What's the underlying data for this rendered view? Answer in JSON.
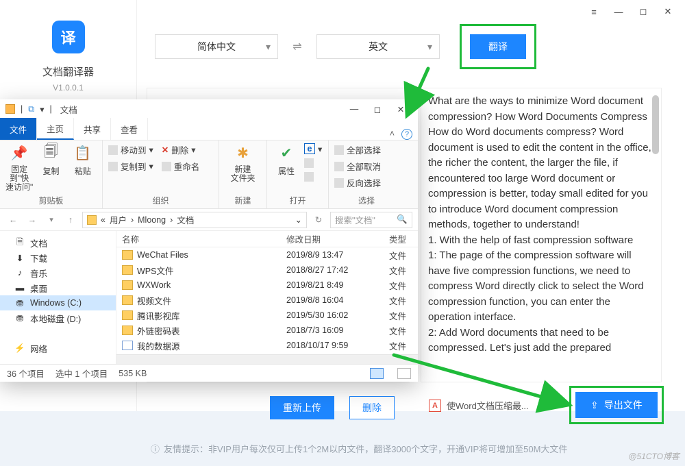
{
  "titlebar": {
    "menu_icon": "≡",
    "min_icon": "—",
    "max_icon": "◻",
    "close_icon": "✕"
  },
  "app": {
    "logo_text": "译",
    "title": "文档翻译器",
    "version": "V1.0.0.1"
  },
  "lang": {
    "src": "简体中文",
    "dst": "英文",
    "swap": "⇌",
    "translate": "翻译"
  },
  "actions": {
    "reupload": "重新上传",
    "delete": "删除",
    "export": "导出文件",
    "export_icon": "⇪"
  },
  "result_file": {
    "name": "使Word文档压缩最...",
    "icon_label": "A"
  },
  "result_text": "What are the ways to minimize Word document compression? How Word Documents Compress How do Word documents compress? Word document is used to edit the content in the office, the richer the content, the larger the file, if encountered too large Word document or compression is better, today small edited for you to introduce Word document compression methods, together to understand!\n1. With the help of fast compression software\n1: The page of the compression software will have five compression functions, we need to compress Word directly click to select the Word compression function, you can enter the operation interface.\n2: Add Word documents that need to be compressed. Let's just add the prepared",
  "hint": {
    "icon": "ⓘ",
    "text": "友情提示：非VIP用户每次仅可上传1个2M以内文件，翻译3000个文字，开通VIP将可增加至50M大文件"
  },
  "watermark": "@51CTO博客",
  "explorer": {
    "qat_chevron": "▾",
    "sep": "|",
    "title": "文档",
    "tabs": {
      "file": "文件",
      "home": "主页",
      "share": "共享",
      "view": "查看",
      "expand": "˄",
      "help": "?"
    },
    "ribbon": {
      "grp_clipboard": "剪贴板",
      "pin": "固定到\"快\n速访问\"",
      "copy": "复制",
      "paste": "粘贴",
      "grp_organize": "组织",
      "moveTo": "移动到",
      "copyTo": "复制到",
      "delete": "删除",
      "rename": "重命名",
      "del_icon": "✕",
      "grp_new": "新建",
      "newFolder": "新建\n文件夹",
      "newfolder_icon": "✱",
      "grp_open": "打开",
      "properties": "属性",
      "prop_icon": "✔",
      "edge_icon": "e",
      "grp_select": "选择",
      "selAll": "全部选择",
      "selNone": "全部取消",
      "selInv": "反向选择"
    },
    "addr": {
      "back": "←",
      "fwd": "→",
      "up": "↑",
      "chev": "›",
      "refresh": "↻",
      "dropdown": "⌄",
      "p1": "«",
      "p2": "用户",
      "p3": "Mloong",
      "p4": "文档",
      "search_ph": "搜索\"文档\"",
      "search_icon": "🔍"
    },
    "nav": [
      {
        "icon": "🗎",
        "label": "文档"
      },
      {
        "icon": "⬇",
        "label": "下载"
      },
      {
        "icon": "♪",
        "label": "音乐"
      },
      {
        "icon": "▬",
        "label": "桌面"
      },
      {
        "icon": "⛃",
        "label": "Windows (C:)",
        "selected": true
      },
      {
        "icon": "⛃",
        "label": "本地磁盘 (D:)"
      },
      {
        "icon": "",
        "label": ""
      },
      {
        "icon": "⚡",
        "label": "网络"
      }
    ],
    "cols": {
      "name": "名称",
      "date": "修改日期",
      "type": "类型"
    },
    "files": [
      {
        "name": "WeChat Files",
        "date": "2019/8/9 13:47",
        "type": "文件"
      },
      {
        "name": "WPS文件",
        "date": "2018/8/27 17:42",
        "type": "文件"
      },
      {
        "name": "WXWork",
        "date": "2019/8/21 8:49",
        "type": "文件"
      },
      {
        "name": "视频文件",
        "date": "2019/8/8 16:04",
        "type": "文件"
      },
      {
        "name": "腾讯影视库",
        "date": "2019/5/30 16:02",
        "type": "文件"
      },
      {
        "name": "外链密码表",
        "date": "2018/7/3 16:09",
        "type": "文件"
      },
      {
        "name": "我的数据源",
        "date": "2018/10/17 9:59",
        "type": "文件",
        "db": true
      }
    ],
    "status": {
      "count": "36 个项目",
      "sel": "选中 1 个项目",
      "size": "535 KB"
    }
  }
}
